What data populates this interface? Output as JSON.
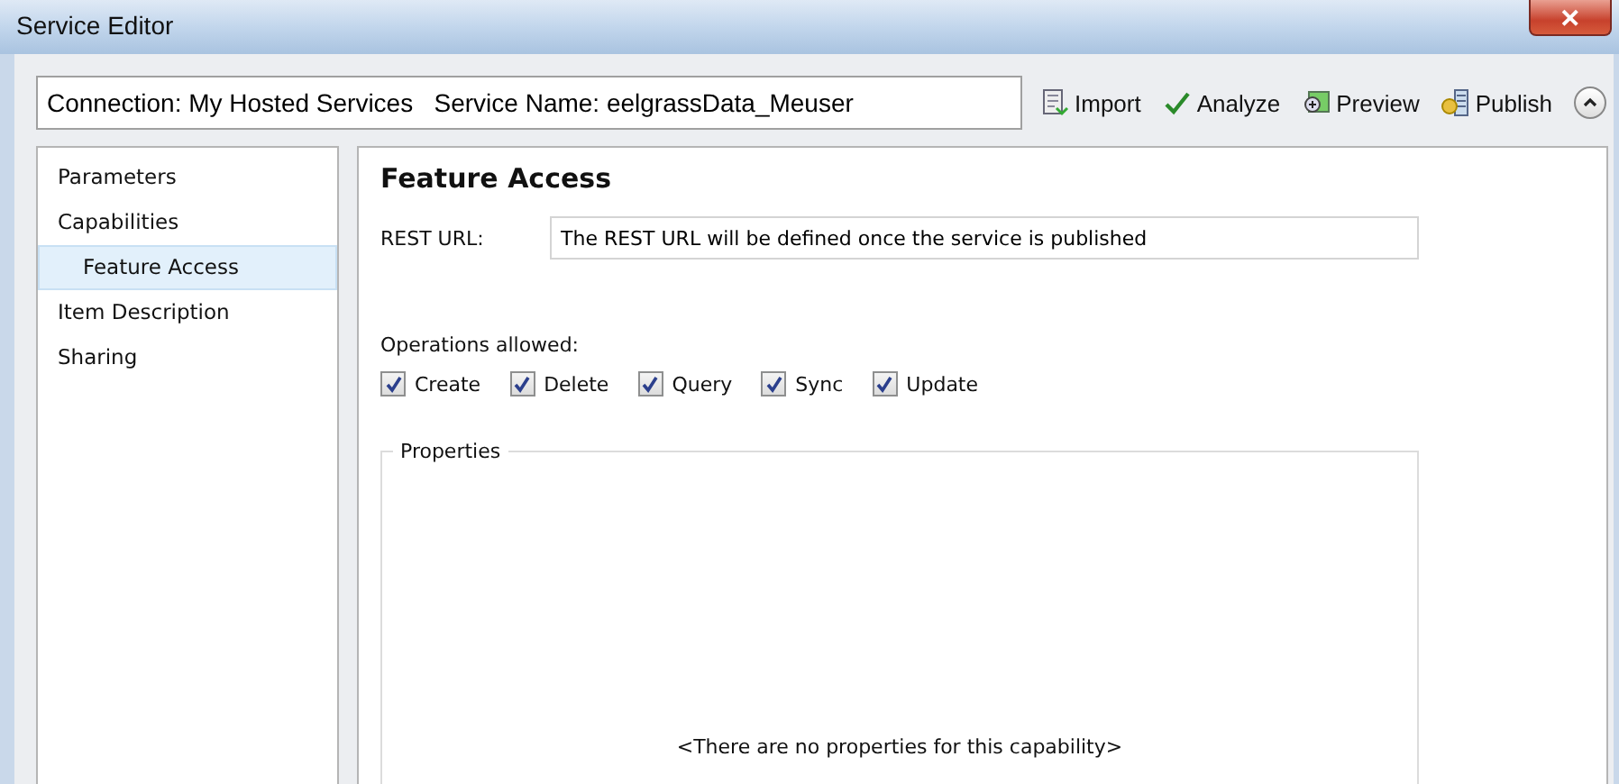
{
  "window": {
    "title": "Service Editor",
    "close": "✕"
  },
  "connection_field": {
    "value": "Connection: My Hosted Services   Service Name: eelgrassData_Meuser"
  },
  "toolbar": [
    {
      "kind": "import",
      "label": "Import"
    },
    {
      "kind": "analyze",
      "label": "Analyze"
    },
    {
      "kind": "preview",
      "label": "Preview"
    },
    {
      "kind": "publish",
      "label": "Publish"
    },
    {
      "kind": "collapse"
    }
  ],
  "sidebar": {
    "items": [
      {
        "label": "Parameters",
        "selected": false
      },
      {
        "label": "Capabilities",
        "selected": false,
        "children": [
          {
            "label": "Feature Access",
            "selected": true
          }
        ]
      },
      {
        "label": "Item Description",
        "selected": false
      },
      {
        "label": "Sharing",
        "selected": false
      }
    ]
  },
  "panel": {
    "title": "Feature Access",
    "rest_url_label": "REST URL:",
    "rest_url_value": "The REST URL will be defined once the service is published",
    "operations_label": "Operations allowed:",
    "operations": [
      {
        "label": "Create",
        "checked": true
      },
      {
        "label": "Delete",
        "checked": true
      },
      {
        "label": "Query",
        "checked": true
      },
      {
        "label": "Sync",
        "checked": true
      },
      {
        "label": "Update",
        "checked": true
      }
    ],
    "properties": {
      "legend": "Properties",
      "message": "<There are no properties for this capability>"
    }
  }
}
